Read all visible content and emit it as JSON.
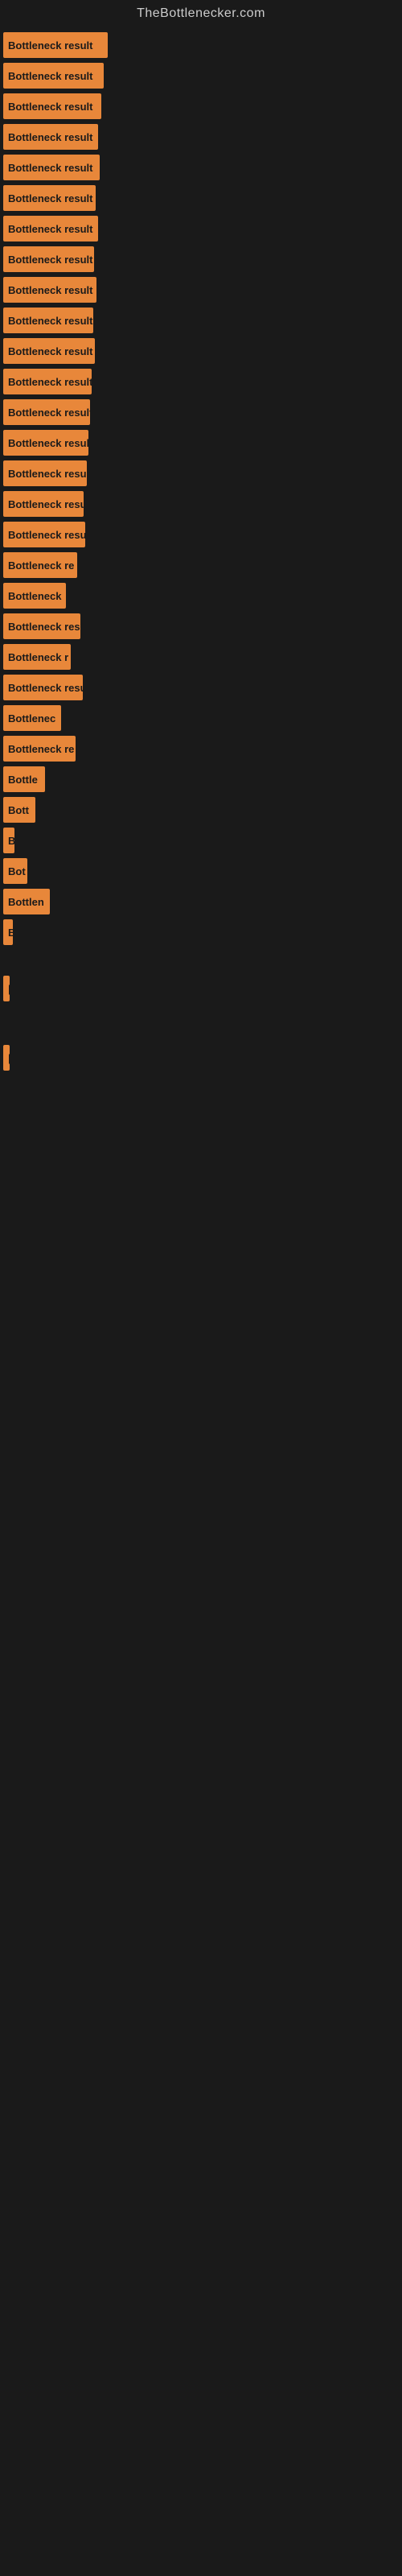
{
  "site": {
    "title": "TheBottlenecker.com"
  },
  "bars": [
    {
      "label": "Bottleneck result",
      "width": 130
    },
    {
      "label": "Bottleneck result",
      "width": 125
    },
    {
      "label": "Bottleneck result",
      "width": 122
    },
    {
      "label": "Bottleneck result",
      "width": 118
    },
    {
      "label": "Bottleneck result",
      "width": 120
    },
    {
      "label": "Bottleneck result",
      "width": 115
    },
    {
      "label": "Bottleneck result",
      "width": 118
    },
    {
      "label": "Bottleneck result",
      "width": 113
    },
    {
      "label": "Bottleneck result",
      "width": 116
    },
    {
      "label": "Bottleneck result",
      "width": 112
    },
    {
      "label": "Bottleneck result",
      "width": 114
    },
    {
      "label": "Bottleneck result",
      "width": 110
    },
    {
      "label": "Bottleneck result",
      "width": 108
    },
    {
      "label": "Bottleneck result",
      "width": 106
    },
    {
      "label": "Bottleneck result",
      "width": 104
    },
    {
      "label": "Bottleneck resu",
      "width": 100
    },
    {
      "label": "Bottleneck result",
      "width": 102
    },
    {
      "label": "Bottleneck re",
      "width": 92
    },
    {
      "label": "Bottleneck",
      "width": 78
    },
    {
      "label": "Bottleneck res",
      "width": 96
    },
    {
      "label": "Bottleneck r",
      "width": 84
    },
    {
      "label": "Bottleneck resu",
      "width": 99
    },
    {
      "label": "Bottlenec",
      "width": 72
    },
    {
      "label": "Bottleneck re",
      "width": 90
    },
    {
      "label": "Bottle",
      "width": 52
    },
    {
      "label": "Bott",
      "width": 40
    },
    {
      "label": "B",
      "width": 14
    },
    {
      "label": "Bot",
      "width": 30
    },
    {
      "label": "Bottlen",
      "width": 58
    },
    {
      "label": "B",
      "width": 12
    },
    {
      "label": "",
      "width": 0
    },
    {
      "label": "",
      "width": 0
    },
    {
      "label": "|",
      "width": 8
    },
    {
      "label": "",
      "width": 0
    },
    {
      "label": "",
      "width": 0
    },
    {
      "label": "",
      "width": 0
    },
    {
      "label": "|",
      "width": 8
    }
  ]
}
